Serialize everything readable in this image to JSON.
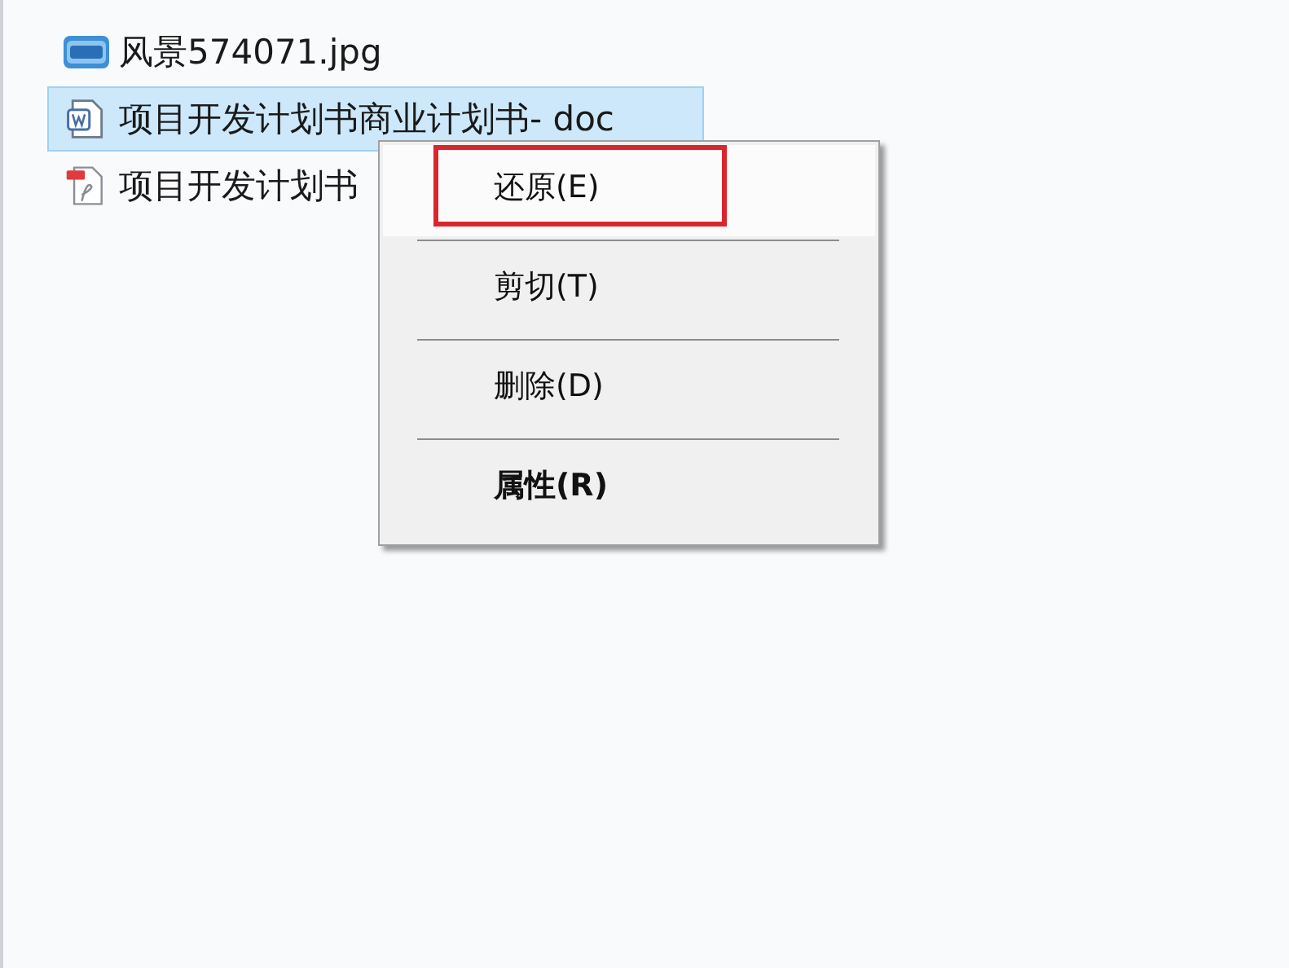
{
  "files": [
    {
      "name": "风景574071.jpg",
      "kind": "jpg",
      "selected": false
    },
    {
      "name": "项目开发计划书商业计划书- doc",
      "kind": "word",
      "selected": true
    },
    {
      "name": "项目开发计划书",
      "kind": "pdf",
      "selected": false
    }
  ],
  "context_menu": {
    "items": [
      {
        "label": "还原(E)",
        "highlighted": true,
        "default": false
      },
      {
        "label": "剪切(T)",
        "highlighted": false,
        "default": false
      },
      {
        "label": "删除(D)",
        "highlighted": false,
        "default": false
      },
      {
        "label": "属性(R)",
        "highlighted": false,
        "default": true
      }
    ]
  }
}
